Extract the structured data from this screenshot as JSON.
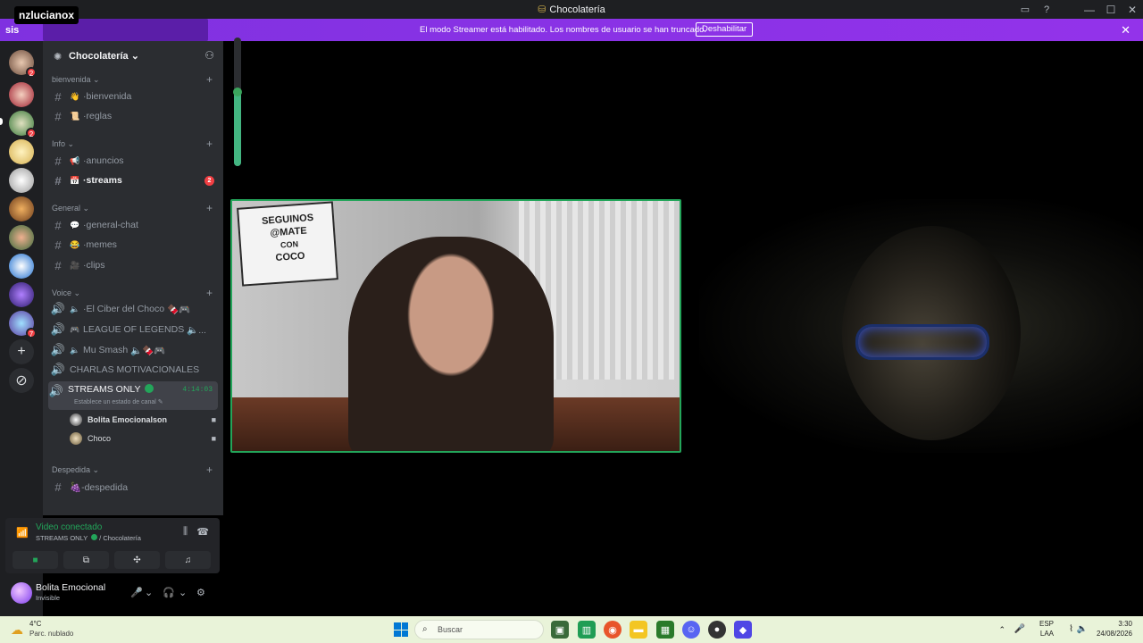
{
  "titlebar": {
    "title": "Chocolatería"
  },
  "overlay": {
    "username": "nzlucianox",
    "sis": "sis"
  },
  "streamer_bar": {
    "message": "El modo Streamer está habilitado. Los nombres de usuario se han truncado.",
    "disable_label": "Deshabilitar"
  },
  "server": {
    "name": "Chocolatería"
  },
  "categories": {
    "bienvenida": "bienvenida",
    "info": "Info",
    "general": "General",
    "voice": "Voice",
    "despedida": "Despedida"
  },
  "channels": {
    "bienvenida": "bienvenida",
    "reglas": "reglas",
    "anuncios": "anuncios",
    "streams": "streams",
    "streams_badge": "2",
    "general_chat": "general-chat",
    "memes": "memes",
    "clips": "clips",
    "despedida": "🍇-despedida"
  },
  "voice_channels": {
    "ciber": "El Ciber del Choco",
    "league": "LEAGUE OF LEGENDS",
    "smash": "Mu Smash",
    "charlas": "CHARLAS MOTIVACIONALES",
    "streams_only": "STREAMS ONLY",
    "streams_only_timer": "4:14:03",
    "streams_only_status": "Establece un estado de canal",
    "users": [
      "Bolita Emocionalson",
      "Choco"
    ]
  },
  "server_badges": {
    "s1": "2",
    "s3": "2",
    "s11": "7"
  },
  "voice_panel": {
    "connection": "Video conectado",
    "channel": "STREAMS ONLY",
    "server": "/ Chocolatería"
  },
  "user_panel": {
    "name": "Bolita Emocional",
    "status": "Invisible"
  },
  "stream": {
    "sign_lines": [
      "SEGUINOS",
      "@MATE",
      "CON",
      "COCO"
    ]
  },
  "taskbar": {
    "temp": "4°C",
    "weather": "Parc. nublado",
    "search_placeholder": "Buscar",
    "lang": "ESP",
    "lang2": "LAA",
    "time": "3:30",
    "date": "24/08/2026"
  },
  "colors": {
    "accent": "#9333ea",
    "green": "#23a55a",
    "red": "#f23f43"
  }
}
